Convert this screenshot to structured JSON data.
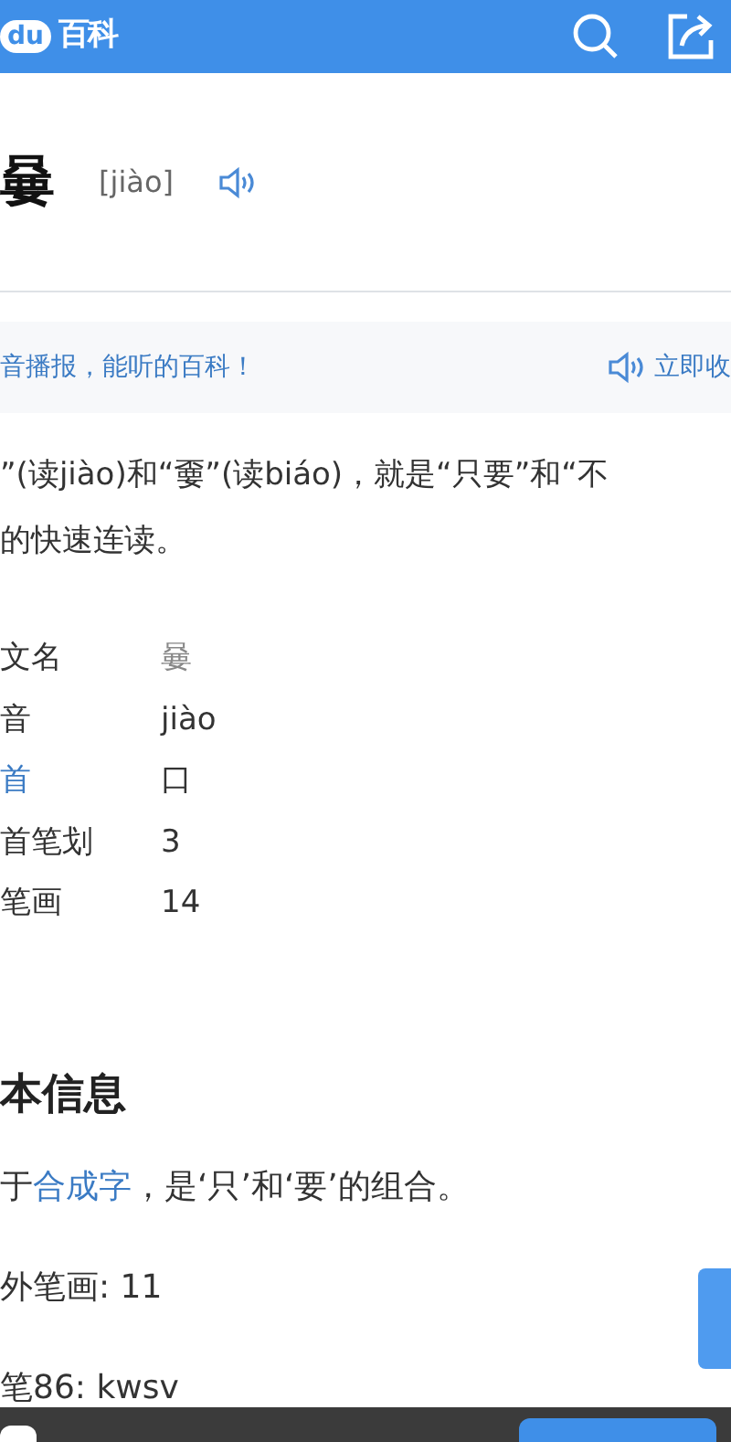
{
  "header": {
    "logo_mark": "du",
    "logo_text": "百科"
  },
  "entry": {
    "title": "嘦",
    "pinyin": "[jiào]"
  },
  "audio_banner": {
    "text": "音播报，能听的百科！",
    "action": "立即收"
  },
  "summary": [
    "”(读jiào)和“嫑”(读biáo)，就是“只要”和“不",
    "的快速连读。"
  ],
  "info_rows": [
    {
      "label": "文名",
      "value": "嘦",
      "link": false,
      "muted": true
    },
    {
      "label": "音",
      "value": "jiào",
      "link": false,
      "muted": false
    },
    {
      "label": "首",
      "value": "口",
      "link": true,
      "muted": false
    },
    {
      "label": "首笔划",
      "value": "3",
      "link": false,
      "muted": false
    },
    {
      "label": "笔画",
      "value": "14",
      "link": false,
      "muted": false
    }
  ],
  "section": {
    "heading": "本信息",
    "intro": {
      "before": "于",
      "link": "合成字",
      "after": "，是‘只’和‘要’的组合。"
    },
    "paragraphs": [
      "外笔画: 11",
      "笔86: kwsv"
    ]
  }
}
